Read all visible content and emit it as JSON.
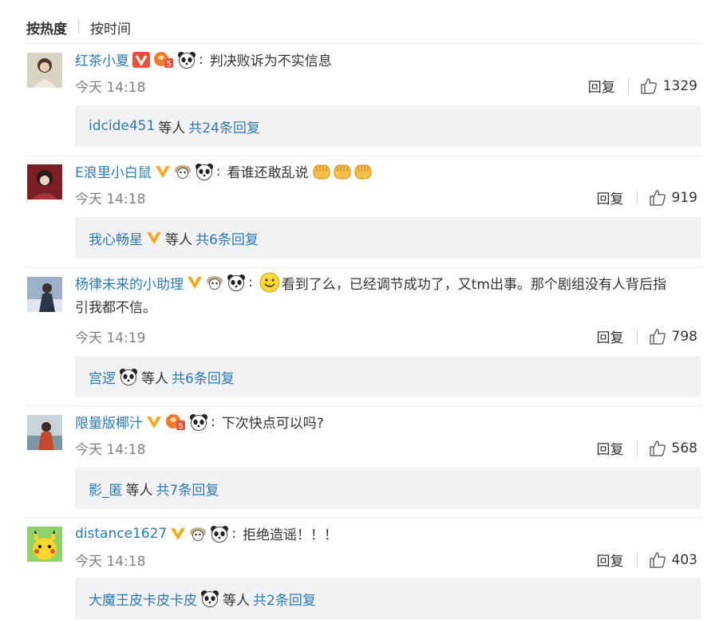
{
  "sort": {
    "hot_label": "按热度",
    "time_label": "按时间"
  },
  "comments": [
    {
      "username": "红茶小夏",
      "text": "判决败诉为不实信息",
      "time": "今天 14:18",
      "reply_label": "回复",
      "likes": "1329",
      "sub_user": "idcide451",
      "sub_mid": "等人",
      "sub_link": "共24条回复"
    },
    {
      "username": "E浪里小白鼠",
      "text": "看谁还敢乱说",
      "time": "今天 14:18",
      "reply_label": "回复",
      "likes": "919",
      "sub_user": "我心畅星",
      "sub_mid": "等人",
      "sub_link": "共6条回复"
    },
    {
      "username": "杨律未来的小助理",
      "text_line1": "看到了么，已经调节成功了，又tm出事。那个剧组没有人背后指",
      "text_line2": "引我都不信。",
      "time": "今天 14:19",
      "reply_label": "回复",
      "likes": "798",
      "sub_user": "宫逻",
      "sub_mid": "等人",
      "sub_link": "共6条回复"
    },
    {
      "username": "限量版椰汁",
      "text": "下次快点可以吗?",
      "time": "今天 14:18",
      "reply_label": "回复",
      "likes": "568",
      "sub_user": "影_匿",
      "sub_mid": "等人",
      "sub_link": "共7条回复"
    },
    {
      "username": "distance1627",
      "text": "拒绝造谣！！！",
      "time": "今天 14:18",
      "reply_label": "回复",
      "likes": "403",
      "sub_user": "大魔王皮卡皮卡皮",
      "sub_mid": "等人",
      "sub_link": "共2条回复"
    }
  ],
  "colors": {
    "link": "#2d7ab2",
    "vip_badge": "#f2a91f",
    "verified_badge": "#e5533d",
    "subbox_bg": "#f2f2f5"
  },
  "icons": [
    "verified-v-icon",
    "vip-v-icon",
    "level-5-icon",
    "sheep-icon",
    "panda-icon",
    "fist-emoji-icon",
    "smile-emoji-icon",
    "thumbs-up-icon"
  ]
}
